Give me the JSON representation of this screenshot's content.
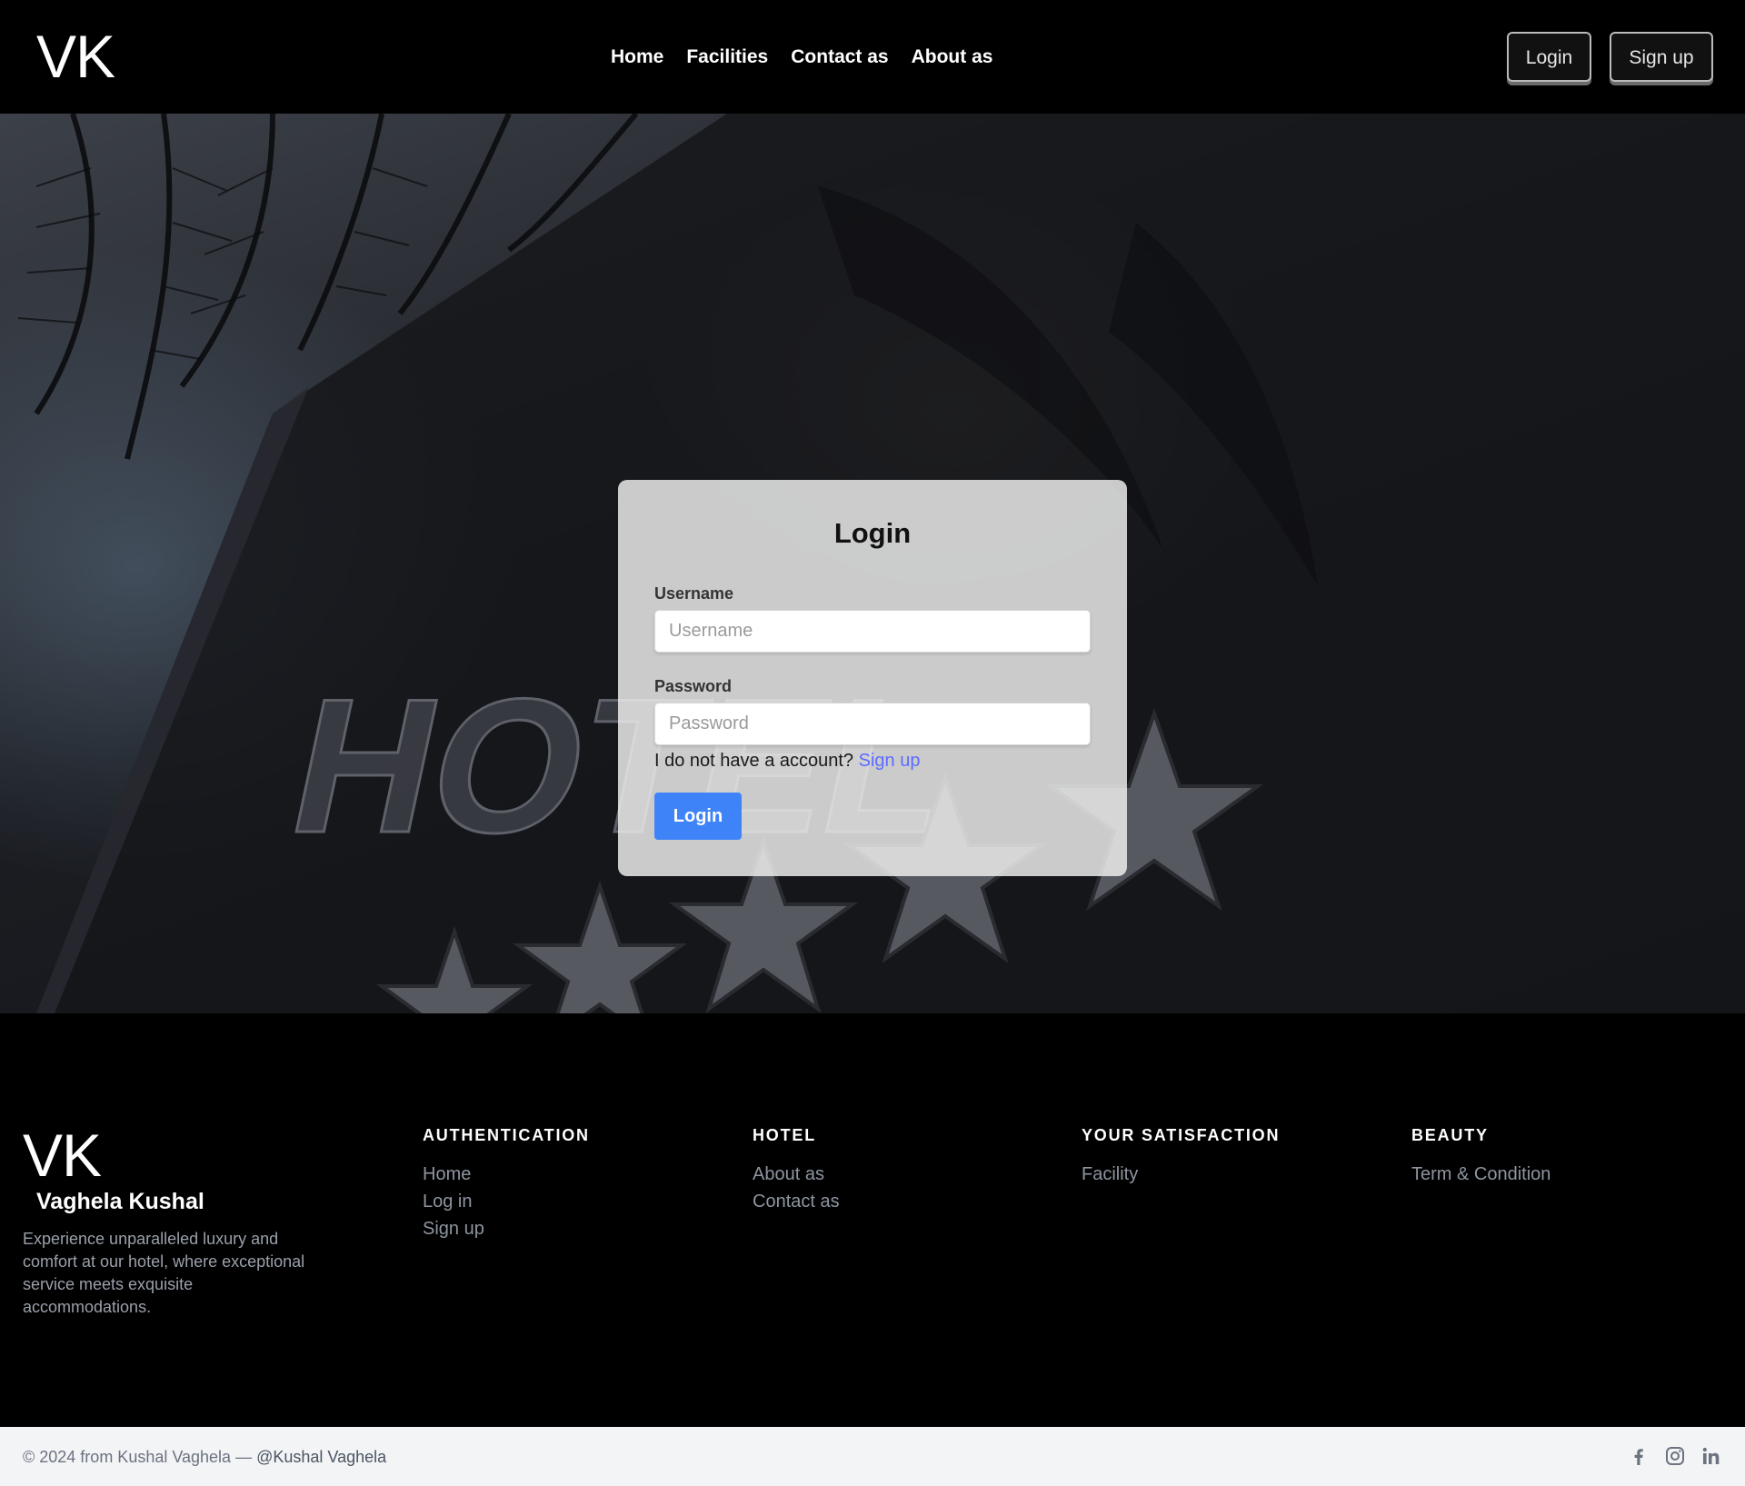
{
  "nav": {
    "brand": "VK",
    "links": [
      "Home",
      "Facilities",
      "Contact as",
      "About as"
    ],
    "login_label": "Login",
    "signup_label": "Sign up"
  },
  "hero": {
    "background_icon": "hotel-facade-image"
  },
  "login_form": {
    "title": "Login",
    "username_label": "Username",
    "username_placeholder": "Username",
    "password_label": "Password",
    "password_placeholder": "Password",
    "no_account_text": "I do not have a account?",
    "signup_link": "Sign up",
    "submit_label": "Login",
    "accent_color": "#3f83f8",
    "link_color": "#5b6cff"
  },
  "footer": {
    "brand": "VK",
    "name": "Vaghela Kushal",
    "description": "Experience unparalleled luxury and comfort at our hotel, where exceptional service meets exquisite accommodations.",
    "columns": [
      {
        "heading": "AUTHENTICATION",
        "links": [
          "Home",
          "Log in",
          "Sign up"
        ]
      },
      {
        "heading": "HOTEL",
        "links": [
          "About as",
          "Contact as"
        ]
      },
      {
        "heading": "YOUR SATISFACTION",
        "links": [
          "Facility"
        ]
      },
      {
        "heading": "BEAUTY",
        "links": [
          "Term & Condition"
        ]
      }
    ]
  },
  "bottom_bar": {
    "copyright": "© 2024 from Kushal Vaghela —",
    "handle": "@Kushal Vaghela",
    "social_icons": [
      "facebook-icon",
      "instagram-icon",
      "linkedin-icon"
    ]
  }
}
